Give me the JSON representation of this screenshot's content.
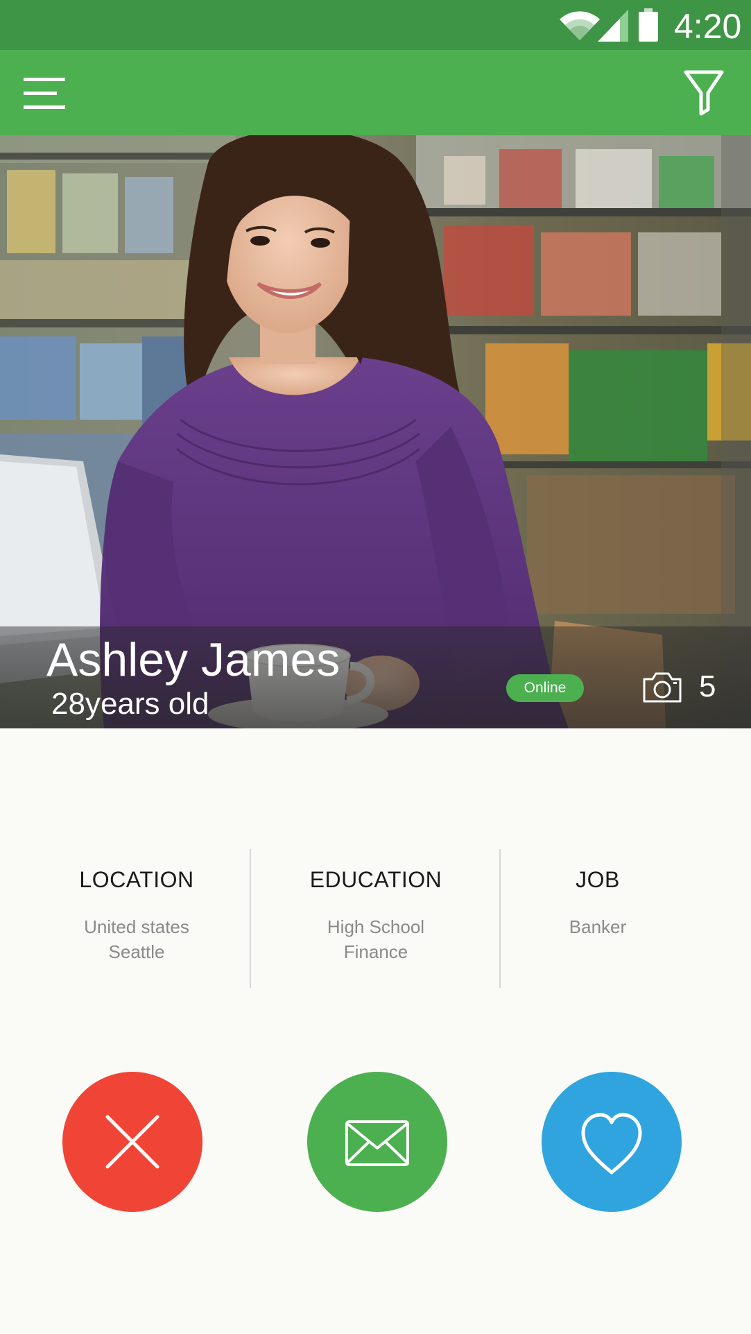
{
  "status_bar": {
    "time": "4:20",
    "icons": [
      "wifi-icon",
      "signal-icon",
      "battery-icon"
    ]
  },
  "app_bar": {
    "menu_icon": "menu-icon",
    "filter_icon": "filter-icon",
    "color": "#4cb050"
  },
  "profile": {
    "name": "Ashley James",
    "age_text": "28years old",
    "status": "Online",
    "photo_count": "5",
    "photo_icon": "camera-icon"
  },
  "info": [
    {
      "title": "LOCATION",
      "line1": "United states",
      "line2": "Seattle"
    },
    {
      "title": "EDUCATION",
      "line1": "High School",
      "line2": "Finance"
    },
    {
      "title": "JOB",
      "line1": "Banker",
      "line2": ""
    }
  ],
  "actions": [
    {
      "name": "reject",
      "icon": "close-icon",
      "color": "#f04536"
    },
    {
      "name": "message",
      "icon": "envelope-icon",
      "color": "#4cb050"
    },
    {
      "name": "like",
      "icon": "heart-icon",
      "color": "#2fa4de"
    }
  ],
  "colors": {
    "status_bar": "#3e9545",
    "accent": "#4cb050",
    "background": "#fafaf7"
  }
}
